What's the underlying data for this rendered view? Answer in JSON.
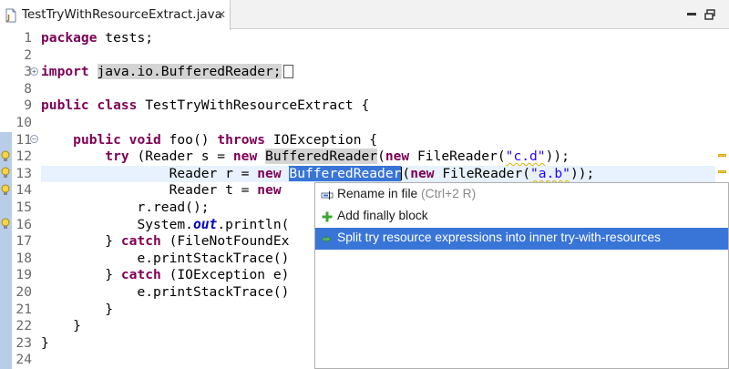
{
  "tab": {
    "title": "TestTryWithResourceExtract.java",
    "close_glyph": "✕",
    "file_icon": "java-file-icon"
  },
  "window_controls": {
    "minimize_icon": "minimize-icon",
    "maximize_icon": "maximize-icon"
  },
  "editor": {
    "line_numbers": [
      "1",
      "2",
      "3",
      "8",
      "9",
      "10",
      "11",
      "12",
      "13",
      "14",
      "15",
      "16",
      "17",
      "18",
      "19",
      "20",
      "21",
      "22",
      "23",
      "24"
    ],
    "lines": {
      "l1_kw": "package",
      "l1_rest": " tests;",
      "l3_kw": "import",
      "l3_space": " ",
      "l3_import": "java.io.BufferedReader;",
      "l9_kw1": "public",
      "l9_sp1": " ",
      "l9_kw2": "class",
      "l9_rest": " TestTryWithResourceExtract {",
      "l11_indent": "    ",
      "l11_kw1": "public",
      "l11_sp1": " ",
      "l11_kw2": "void",
      "l11_mid": " foo() ",
      "l11_kw3": "throws",
      "l11_rest": " IOException {",
      "l12_indent": "        ",
      "l12_kw1": "try",
      "l12_mid1": " (Reader s = ",
      "l12_kw2": "new",
      "l12_sp": " ",
      "l12_occ": "BufferedReader",
      "l12_mid2": "(",
      "l12_kw3": "new",
      "l12_mid3": " FileReader(",
      "l12_str": "\"c.d\"",
      "l12_rest": "));",
      "l13_indent": "                ",
      "l13_mid1": "Reader r = ",
      "l13_kw1": "new",
      "l13_sp": " ",
      "l13_sel": "BufferedReader",
      "l13_mid2": "(",
      "l13_kw2": "new",
      "l13_mid3": " FileReader(",
      "l13_str": "\"a.b\"",
      "l13_rest": "));",
      "l14_indent": "                ",
      "l14_mid1": "Reader t = ",
      "l14_kw1": "new",
      "l15_indent": "            ",
      "l15_rest": "r.read();",
      "l16_indent": "            ",
      "l16_pre": "System.",
      "l16_fld": "out",
      "l16_rest": ".println(",
      "l17_indent": "        ",
      "l17_pre": "} ",
      "l17_kw": "catch",
      "l17_rest": " (FileNotFoundEx",
      "l18_indent": "            ",
      "l18_rest": "e.printStackTrace()",
      "l19_indent": "        ",
      "l19_pre": "} ",
      "l19_kw": "catch",
      "l19_rest": " (IOException e)",
      "l20_indent": "            ",
      "l20_rest": "e.printStackTrace()",
      "l21_indent": "        ",
      "l21_rest": "}",
      "l22_indent": "    ",
      "l22_rest": "}",
      "l23_rest": "}"
    }
  },
  "quick_assist": {
    "items": [
      {
        "label": "Rename in file",
        "shortcut": " (Ctrl+2 R)",
        "icon": "rename-icon"
      },
      {
        "label": "Add finally block",
        "icon": "add-icon"
      },
      {
        "label": "Split try resource expressions into inner try-with-resources",
        "icon": "change-icon"
      }
    ],
    "selected_index": 2
  },
  "colors": {
    "keyword": "#7f0055",
    "string": "#2a00ff",
    "field": "#0000c0",
    "selection": "#3875d7",
    "current_line": "#e8f2fe",
    "warning_marker": "#f3c84b"
  }
}
